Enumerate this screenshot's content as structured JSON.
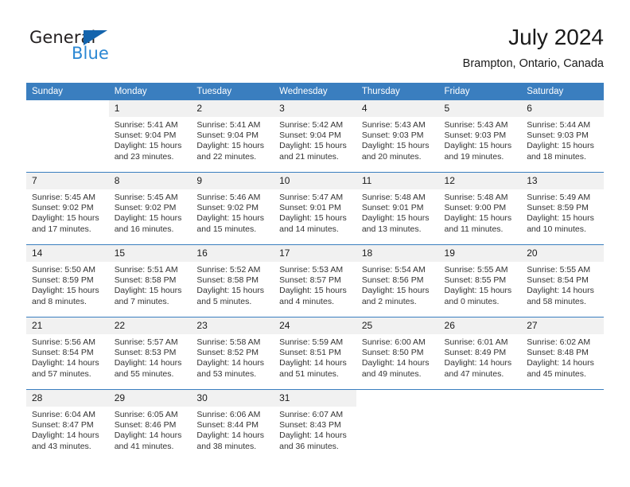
{
  "brand": {
    "name_top": "General",
    "name_bottom": "Blue",
    "triangle_color": "#1464ad",
    "blue_color": "#2b87d3"
  },
  "header": {
    "title": "July 2024",
    "subtitle": "Brampton, Ontario, Canada"
  },
  "calendar": {
    "header_bg": "#3a7ebf",
    "daynum_bg": "#f1f1f1",
    "weekday_headers": [
      "Sunday",
      "Monday",
      "Tuesday",
      "Wednesday",
      "Thursday",
      "Friday",
      "Saturday"
    ],
    "weeks": [
      [
        {
          "day": "",
          "sunrise": "",
          "sunset": "",
          "daylight1": "",
          "daylight2": ""
        },
        {
          "day": "1",
          "sunrise": "Sunrise: 5:41 AM",
          "sunset": "Sunset: 9:04 PM",
          "daylight1": "Daylight: 15 hours",
          "daylight2": "and 23 minutes."
        },
        {
          "day": "2",
          "sunrise": "Sunrise: 5:41 AM",
          "sunset": "Sunset: 9:04 PM",
          "daylight1": "Daylight: 15 hours",
          "daylight2": "and 22 minutes."
        },
        {
          "day": "3",
          "sunrise": "Sunrise: 5:42 AM",
          "sunset": "Sunset: 9:04 PM",
          "daylight1": "Daylight: 15 hours",
          "daylight2": "and 21 minutes."
        },
        {
          "day": "4",
          "sunrise": "Sunrise: 5:43 AM",
          "sunset": "Sunset: 9:03 PM",
          "daylight1": "Daylight: 15 hours",
          "daylight2": "and 20 minutes."
        },
        {
          "day": "5",
          "sunrise": "Sunrise: 5:43 AM",
          "sunset": "Sunset: 9:03 PM",
          "daylight1": "Daylight: 15 hours",
          "daylight2": "and 19 minutes."
        },
        {
          "day": "6",
          "sunrise": "Sunrise: 5:44 AM",
          "sunset": "Sunset: 9:03 PM",
          "daylight1": "Daylight: 15 hours",
          "daylight2": "and 18 minutes."
        }
      ],
      [
        {
          "day": "7",
          "sunrise": "Sunrise: 5:45 AM",
          "sunset": "Sunset: 9:02 PM",
          "daylight1": "Daylight: 15 hours",
          "daylight2": "and 17 minutes."
        },
        {
          "day": "8",
          "sunrise": "Sunrise: 5:45 AM",
          "sunset": "Sunset: 9:02 PM",
          "daylight1": "Daylight: 15 hours",
          "daylight2": "and 16 minutes."
        },
        {
          "day": "9",
          "sunrise": "Sunrise: 5:46 AM",
          "sunset": "Sunset: 9:02 PM",
          "daylight1": "Daylight: 15 hours",
          "daylight2": "and 15 minutes."
        },
        {
          "day": "10",
          "sunrise": "Sunrise: 5:47 AM",
          "sunset": "Sunset: 9:01 PM",
          "daylight1": "Daylight: 15 hours",
          "daylight2": "and 14 minutes."
        },
        {
          "day": "11",
          "sunrise": "Sunrise: 5:48 AM",
          "sunset": "Sunset: 9:01 PM",
          "daylight1": "Daylight: 15 hours",
          "daylight2": "and 13 minutes."
        },
        {
          "day": "12",
          "sunrise": "Sunrise: 5:48 AM",
          "sunset": "Sunset: 9:00 PM",
          "daylight1": "Daylight: 15 hours",
          "daylight2": "and 11 minutes."
        },
        {
          "day": "13",
          "sunrise": "Sunrise: 5:49 AM",
          "sunset": "Sunset: 8:59 PM",
          "daylight1": "Daylight: 15 hours",
          "daylight2": "and 10 minutes."
        }
      ],
      [
        {
          "day": "14",
          "sunrise": "Sunrise: 5:50 AM",
          "sunset": "Sunset: 8:59 PM",
          "daylight1": "Daylight: 15 hours",
          "daylight2": "and 8 minutes."
        },
        {
          "day": "15",
          "sunrise": "Sunrise: 5:51 AM",
          "sunset": "Sunset: 8:58 PM",
          "daylight1": "Daylight: 15 hours",
          "daylight2": "and 7 minutes."
        },
        {
          "day": "16",
          "sunrise": "Sunrise: 5:52 AM",
          "sunset": "Sunset: 8:58 PM",
          "daylight1": "Daylight: 15 hours",
          "daylight2": "and 5 minutes."
        },
        {
          "day": "17",
          "sunrise": "Sunrise: 5:53 AM",
          "sunset": "Sunset: 8:57 PM",
          "daylight1": "Daylight: 15 hours",
          "daylight2": "and 4 minutes."
        },
        {
          "day": "18",
          "sunrise": "Sunrise: 5:54 AM",
          "sunset": "Sunset: 8:56 PM",
          "daylight1": "Daylight: 15 hours",
          "daylight2": "and 2 minutes."
        },
        {
          "day": "19",
          "sunrise": "Sunrise: 5:55 AM",
          "sunset": "Sunset: 8:55 PM",
          "daylight1": "Daylight: 15 hours",
          "daylight2": "and 0 minutes."
        },
        {
          "day": "20",
          "sunrise": "Sunrise: 5:55 AM",
          "sunset": "Sunset: 8:54 PM",
          "daylight1": "Daylight: 14 hours",
          "daylight2": "and 58 minutes."
        }
      ],
      [
        {
          "day": "21",
          "sunrise": "Sunrise: 5:56 AM",
          "sunset": "Sunset: 8:54 PM",
          "daylight1": "Daylight: 14 hours",
          "daylight2": "and 57 minutes."
        },
        {
          "day": "22",
          "sunrise": "Sunrise: 5:57 AM",
          "sunset": "Sunset: 8:53 PM",
          "daylight1": "Daylight: 14 hours",
          "daylight2": "and 55 minutes."
        },
        {
          "day": "23",
          "sunrise": "Sunrise: 5:58 AM",
          "sunset": "Sunset: 8:52 PM",
          "daylight1": "Daylight: 14 hours",
          "daylight2": "and 53 minutes."
        },
        {
          "day": "24",
          "sunrise": "Sunrise: 5:59 AM",
          "sunset": "Sunset: 8:51 PM",
          "daylight1": "Daylight: 14 hours",
          "daylight2": "and 51 minutes."
        },
        {
          "day": "25",
          "sunrise": "Sunrise: 6:00 AM",
          "sunset": "Sunset: 8:50 PM",
          "daylight1": "Daylight: 14 hours",
          "daylight2": "and 49 minutes."
        },
        {
          "day": "26",
          "sunrise": "Sunrise: 6:01 AM",
          "sunset": "Sunset: 8:49 PM",
          "daylight1": "Daylight: 14 hours",
          "daylight2": "and 47 minutes."
        },
        {
          "day": "27",
          "sunrise": "Sunrise: 6:02 AM",
          "sunset": "Sunset: 8:48 PM",
          "daylight1": "Daylight: 14 hours",
          "daylight2": "and 45 minutes."
        }
      ],
      [
        {
          "day": "28",
          "sunrise": "Sunrise: 6:04 AM",
          "sunset": "Sunset: 8:47 PM",
          "daylight1": "Daylight: 14 hours",
          "daylight2": "and 43 minutes."
        },
        {
          "day": "29",
          "sunrise": "Sunrise: 6:05 AM",
          "sunset": "Sunset: 8:46 PM",
          "daylight1": "Daylight: 14 hours",
          "daylight2": "and 41 minutes."
        },
        {
          "day": "30",
          "sunrise": "Sunrise: 6:06 AM",
          "sunset": "Sunset: 8:44 PM",
          "daylight1": "Daylight: 14 hours",
          "daylight2": "and 38 minutes."
        },
        {
          "day": "31",
          "sunrise": "Sunrise: 6:07 AM",
          "sunset": "Sunset: 8:43 PM",
          "daylight1": "Daylight: 14 hours",
          "daylight2": "and 36 minutes."
        },
        {
          "day": "",
          "sunrise": "",
          "sunset": "",
          "daylight1": "",
          "daylight2": ""
        },
        {
          "day": "",
          "sunrise": "",
          "sunset": "",
          "daylight1": "",
          "daylight2": ""
        },
        {
          "day": "",
          "sunrise": "",
          "sunset": "",
          "daylight1": "",
          "daylight2": ""
        }
      ]
    ]
  }
}
